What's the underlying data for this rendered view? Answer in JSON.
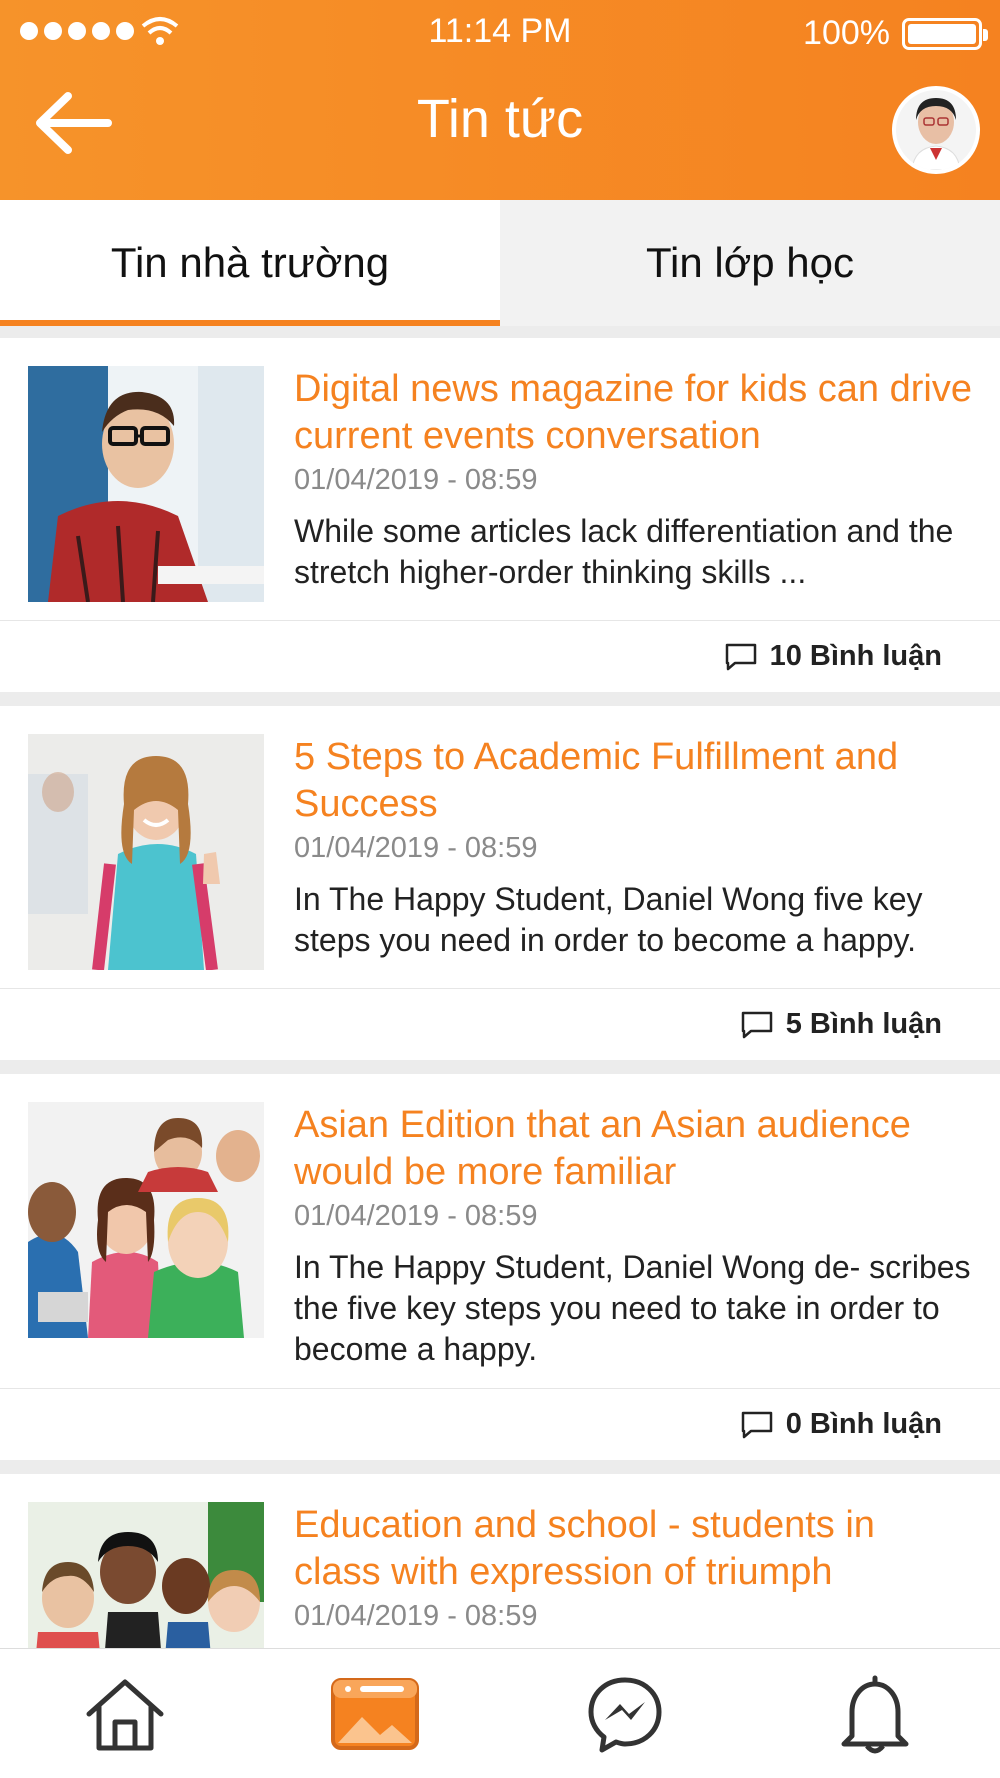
{
  "status_bar": {
    "time": "11:14 PM",
    "battery": "100%"
  },
  "header": {
    "title": "Tin tức",
    "back_icon": "arrow-left-icon",
    "avatar": "user-avatar"
  },
  "tabs": [
    {
      "label": "Tin nhà trường",
      "active": true
    },
    {
      "label": "Tin lớp học",
      "active": false
    }
  ],
  "articles": [
    {
      "title": "Digital news magazine for kids can drive current events conversation",
      "date": "01/04/2019 - 08:59",
      "excerpt": "While some articles lack differentiation and the stretch higher-order thinking skills ...",
      "comments": "10 Bình luận"
    },
    {
      "title": "5 Steps to Academic Fulfillment and Success",
      "date": "01/04/2019 - 08:59",
      "excerpt": "In The Happy Student, Daniel Wong five key steps you need in order to become a happy.",
      "comments": "5 Bình luận"
    },
    {
      "title": "Asian Edition that an Asian audience would be more familiar",
      "date": "01/04/2019 - 08:59",
      "excerpt": "In The Happy Student, Daniel Wong de- scribes the five key steps you need to take in order to become a happy.",
      "comments": "0 Bình luận"
    },
    {
      "title": "Education and school - students in class with expression of triumph",
      "date": "01/04/2019 - 08:59",
      "excerpt": "",
      "comments": ""
    }
  ],
  "bottom_nav": [
    {
      "icon": "home-icon",
      "active": false
    },
    {
      "icon": "news-icon",
      "active": true
    },
    {
      "icon": "messenger-icon",
      "active": false
    },
    {
      "icon": "bell-icon",
      "active": false
    }
  ],
  "colors": {
    "accent": "#f58220",
    "text": "#222222",
    "muted": "#8a8a8a",
    "background": "#ececec"
  }
}
